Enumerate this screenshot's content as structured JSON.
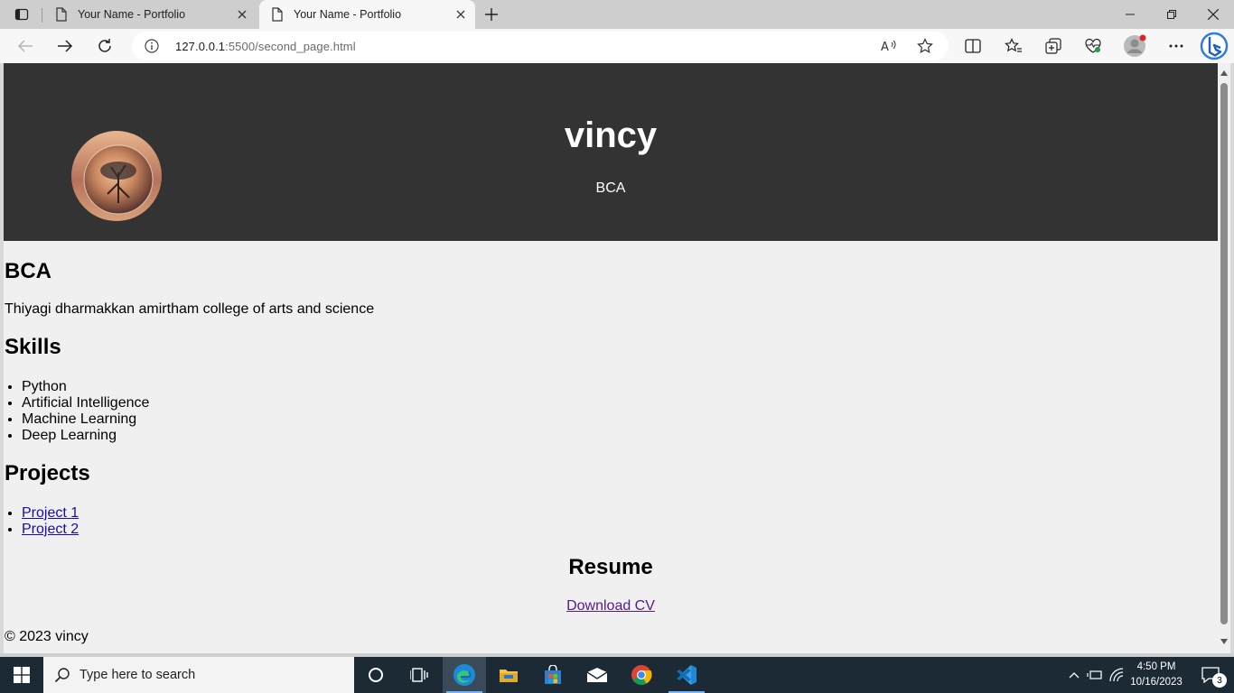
{
  "browser": {
    "tabs": [
      {
        "title": "Your Name - Portfolio",
        "active": false
      },
      {
        "title": "Your Name - Portfolio",
        "active": true
      }
    ],
    "address": {
      "host": "127.0.0.1",
      "port_path": ":5500/second_page.html"
    },
    "icons": {
      "tab_actions": "tab-actions-icon",
      "page": "page-icon",
      "close": "close-icon",
      "new_tab": "plus-icon",
      "back": "back-arrow-icon",
      "forward": "forward-arrow-icon",
      "refresh": "refresh-icon",
      "info": "info-icon",
      "read_aloud": "read-aloud-icon",
      "favorite": "star-icon",
      "split_screen": "split-screen-icon",
      "favorites": "favorites-icon",
      "collections": "collections-icon",
      "browser_essentials": "heart-pulse-icon",
      "profile": "profile-avatar-icon",
      "more": "more-icon",
      "copilot": "bing-copilot-icon"
    }
  },
  "page": {
    "hero": {
      "name": "vincy",
      "degree": "BCA"
    },
    "education": {
      "heading": "BCA",
      "college": "Thiyagi dharmakkan amirtham college of arts and science"
    },
    "skills": {
      "heading": "Skills",
      "items": [
        "Python",
        "Artificial Intelligence",
        "Machine Learning",
        "Deep Learning"
      ]
    },
    "projects": {
      "heading": "Projects",
      "items": [
        "Project 1",
        "Project 2"
      ]
    },
    "resume": {
      "heading": "Resume",
      "link": "Download CV"
    },
    "footer": "© 2023 vincy"
  },
  "taskbar": {
    "search_placeholder": "Type here to search",
    "apps": [
      "cortana-icon",
      "task-view-icon",
      "edge-icon",
      "file-explorer-icon",
      "store-icon",
      "mail-icon",
      "chrome-icon",
      "vscode-icon"
    ],
    "active_app": "edge-icon",
    "clock": {
      "time": "4:50 PM",
      "date": "10/16/2023"
    },
    "notifications_count": "3"
  },
  "colors": {
    "hero_bg": "#333333",
    "page_bg": "#f0f0f0",
    "taskbar_bg": "#1c2a36",
    "link": "#1a0dab",
    "visited_link": "#551a8b"
  }
}
